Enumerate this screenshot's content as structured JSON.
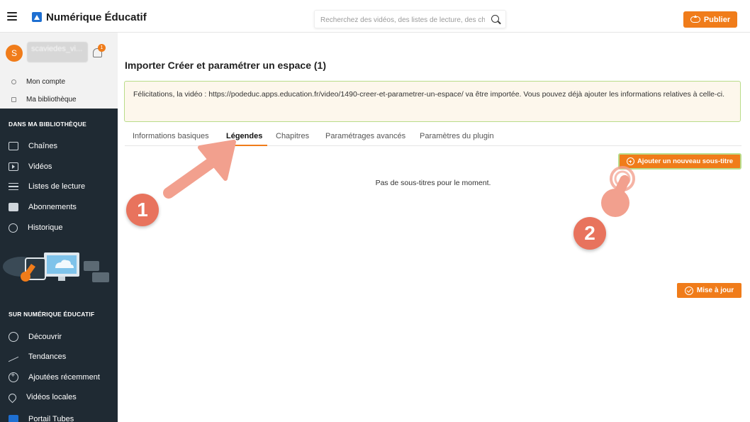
{
  "header": {
    "brand": "Numérique Éducatif",
    "search_placeholder": "Recherchez des vidéos, des listes de lecture, des chaînes",
    "publish_label": "Publier"
  },
  "user": {
    "initial": "S",
    "name": "scaviedes_vi...",
    "notification_count": "1",
    "links": [
      "Mon compte",
      "Ma bibliothèque"
    ]
  },
  "sidebar": {
    "library_title": "DANS MA BIBLIOTHÈQUE",
    "library_items": [
      {
        "label": "Chaînes",
        "icon": "channels-icon"
      },
      {
        "label": "Vidéos",
        "icon": "video-icon"
      },
      {
        "label": "Listes de lecture",
        "icon": "playlist-icon"
      },
      {
        "label": "Abonnements",
        "icon": "subscriptions-icon"
      },
      {
        "label": "Historique",
        "icon": "history-icon"
      }
    ],
    "site_title": "SUR NUMÉRIQUE ÉDUCATIF",
    "site_items": [
      {
        "label": "Découvrir",
        "icon": "globe-icon"
      },
      {
        "label": "Tendances",
        "icon": "trending-icon"
      },
      {
        "label": "Ajoutées récemment",
        "icon": "plus-circle-icon"
      },
      {
        "label": "Vidéos locales",
        "icon": "location-icon"
      },
      {
        "label": "Portail Tubes",
        "icon": "portal-icon"
      }
    ]
  },
  "main": {
    "title": "Importer Créer et paramétrer un espace (1)",
    "alert_text": "Félicitations, la vidéo : https://podeduc.apps.education.fr/video/1490-creer-et-parametrer-un-espace/ va être importée. Vous pouvez déjà ajouter les informations relatives à celle-ci.",
    "tabs": [
      "Informations basiques",
      "Légendes",
      "Chapitres",
      "Paramétrages avancés",
      "Paramètres du plugin"
    ],
    "active_tab": "Légendes",
    "add_subtitle_label": "Ajouter un nouveau sous-titre",
    "empty_message": "Pas de sous-titres pour le moment.",
    "update_label": "Mise à jour"
  },
  "annotations": {
    "step1": "1",
    "step2": "2"
  },
  "colors": {
    "accent": "#f07c1a",
    "sidebar_bg": "#1f2a33",
    "alert_border": "#b9dc8a",
    "annotation": "#e8735d"
  }
}
